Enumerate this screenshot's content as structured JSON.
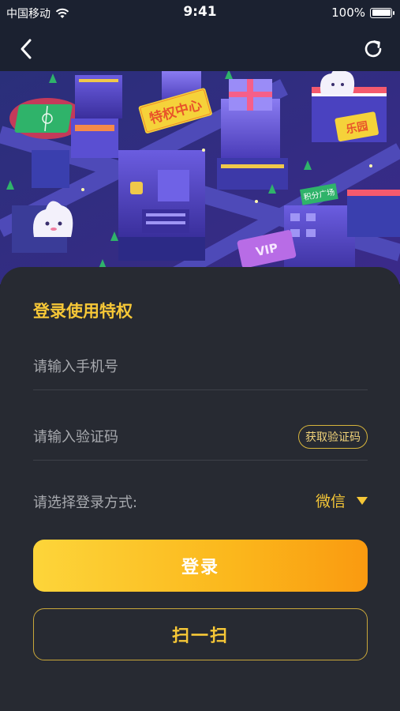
{
  "status_bar": {
    "carrier": "中国移动",
    "time": "9:41",
    "battery": "100%"
  },
  "nav": {
    "back_icon": "chevron-left-icon",
    "refresh_icon": "refresh-icon"
  },
  "banner": {
    "sign_text": "特权中心",
    "shop_text": "乐园",
    "mini_sign": "积分广场",
    "vip_text": "VIP"
  },
  "login": {
    "title": "登录使用特权",
    "phone_placeholder": "请输入手机号",
    "code_placeholder": "请输入验证码",
    "get_code_label": "获取验证码",
    "method_label": "请选择登录方式:",
    "method_value": "微信",
    "login_button": "登录",
    "scan_button": "扫一扫"
  },
  "colors": {
    "accent": "#f6c737",
    "background": "#1f232b",
    "card": "#272a32"
  }
}
